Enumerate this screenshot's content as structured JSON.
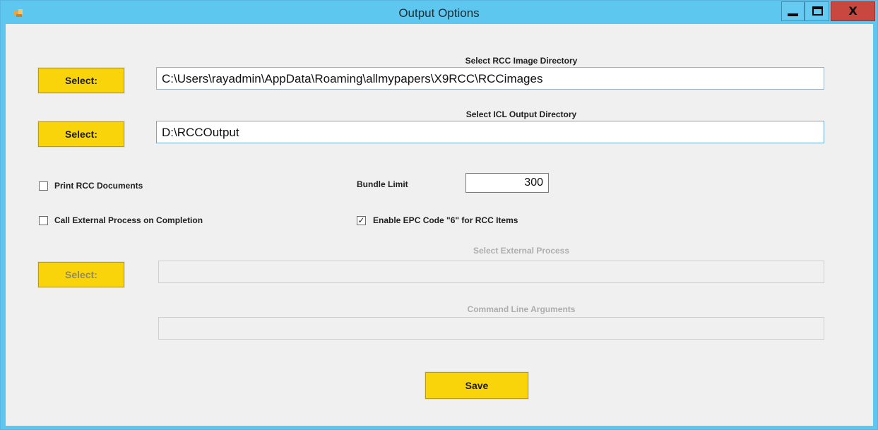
{
  "window": {
    "title": "Output Options",
    "icon": "app-icon",
    "minimize_icon": "minimize-icon",
    "maximize_icon": "maximize-icon",
    "close_label": "X"
  },
  "rcc_image_dir": {
    "label": "Select RCC Image Directory",
    "button": "Select:",
    "value": "C:\\Users\\rayadmin\\AppData\\Roaming\\allmypapers\\X9RCC\\RCCimages"
  },
  "icl_output_dir": {
    "label": "Select ICL Output Directory",
    "button": "Select:",
    "value": "D:\\RCCOutput"
  },
  "print_rcc": {
    "label": "Print RCC Documents",
    "checked": false
  },
  "bundle_limit": {
    "label": "Bundle Limit",
    "value": "300"
  },
  "call_external": {
    "label": "Call External Process on Completion",
    "checked": false
  },
  "enable_epc": {
    "label": "Enable EPC Code \"6\" for RCC Items",
    "checked": true,
    "mark": "✓"
  },
  "external_process": {
    "label": "Select External Process",
    "button": "Select:",
    "value": "",
    "enabled": false
  },
  "command_args": {
    "label": "Command Line Arguments",
    "value": "",
    "enabled": false
  },
  "save_button": "Save",
  "colors": {
    "titlebar": "#5ec7ef",
    "button_yellow": "#f9d40a",
    "close_red": "#c8473e",
    "client_bg": "#f0f0f0"
  }
}
